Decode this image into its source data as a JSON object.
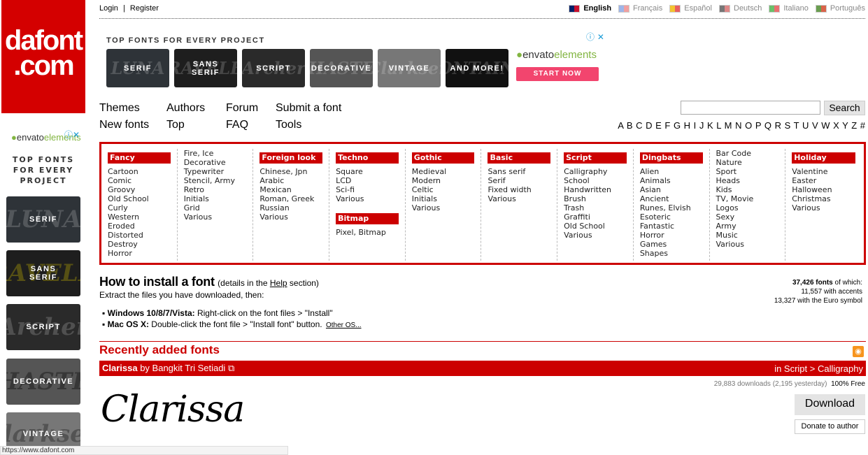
{
  "logo": {
    "line1": "dafont",
    ".com": ".com",
    "line2": ".com"
  },
  "top": {
    "login": "Login",
    "sep": "|",
    "register": "Register"
  },
  "languages": [
    {
      "label": "English",
      "active": true,
      "colors": [
        "#012169",
        "#c8102e"
      ]
    },
    {
      "label": "Français",
      "active": false,
      "colors": [
        "#9db5e8",
        "#f0a0a0"
      ]
    },
    {
      "label": "Español",
      "active": false,
      "colors": [
        "#f4c430",
        "#e86060"
      ]
    },
    {
      "label": "Deutsch",
      "active": false,
      "colors": [
        "#777",
        "#d88"
      ]
    },
    {
      "label": "Italiano",
      "active": false,
      "colors": [
        "#6bbf6b",
        "#e87070"
      ]
    },
    {
      "label": "Português",
      "active": false,
      "colors": [
        "#6a9e50",
        "#d9634a"
      ]
    }
  ],
  "ad": {
    "title": "TOP FONTS FOR EVERY PROJECT",
    "brand1": "envato",
    "brand2": "elements",
    "cta": "START NOW",
    "tiles": [
      {
        "label": "SERIF",
        "bg": "LUNA"
      },
      {
        "label": "SANS SERIF",
        "bg": "TRAVELER"
      },
      {
        "label": "SCRIPT",
        "bg": "Archer"
      },
      {
        "label": "DECORATIVE",
        "bg": "HASTE"
      },
      {
        "label": "VINTAGE",
        "bg": "Clarksen"
      },
      {
        "label": "AND MORE!",
        "bg": "FONTAINE"
      }
    ]
  },
  "side_ad": {
    "title_lines": [
      "TOP FONTS",
      "FOR EVERY",
      "PROJECT"
    ]
  },
  "nav": {
    "themes": "Themes",
    "new_fonts": "New fonts",
    "authors": "Authors",
    "top": "Top",
    "forum": "Forum",
    "faq": "FAQ",
    "submit": "Submit a font",
    "tools": "Tools"
  },
  "search": {
    "value": "",
    "button": "Search"
  },
  "alphabet": "A B C D E F G H I J K L M N O P Q R S T U V W X Y Z #",
  "categories": [
    {
      "header": "Fancy",
      "items": [
        "Cartoon",
        "Comic",
        "Groovy",
        "Old School",
        "Curly",
        "Western",
        "Eroded",
        "Distorted",
        "Destroy",
        "Horror"
      ]
    },
    {
      "header": "",
      "items": [
        "Fire, Ice",
        "Decorative",
        "Typewriter",
        "Stencil, Army",
        "Retro",
        "Initials",
        "Grid",
        "Various"
      ]
    },
    {
      "header": "Foreign look",
      "items": [
        "Chinese, Jpn",
        "Arabic",
        "Mexican",
        "Roman, Greek",
        "Russian",
        "Various"
      ]
    },
    {
      "header": "Techno",
      "items": [
        "Square",
        "LCD",
        "Sci-fi",
        "Various"
      ],
      "header2": "Bitmap",
      "items2": [
        "Pixel, Bitmap"
      ]
    },
    {
      "header": "Gothic",
      "items": [
        "Medieval",
        "Modern",
        "Celtic",
        "Initials",
        "Various"
      ]
    },
    {
      "header": "Basic",
      "items": [
        "Sans serif",
        "Serif",
        "Fixed width",
        "Various"
      ]
    },
    {
      "header": "Script",
      "items": [
        "Calligraphy",
        "School",
        "Handwritten",
        "Brush",
        "Trash",
        "Graffiti",
        "Old School",
        "Various"
      ]
    },
    {
      "header": "Dingbats",
      "items": [
        "Alien",
        "Animals",
        "Asian",
        "Ancient",
        "Runes, Elvish",
        "Esoteric",
        "Fantastic",
        "Horror",
        "Games",
        "Shapes"
      ]
    },
    {
      "header": "",
      "items": [
        "Bar Code",
        "Nature",
        "Sport",
        "Heads",
        "Kids",
        "TV, Movie",
        "Logos",
        "Sexy",
        "Army",
        "Music",
        "Various"
      ]
    },
    {
      "header": "Holiday",
      "items": [
        "Valentine",
        "Easter",
        "Halloween",
        "Christmas",
        "Various"
      ]
    }
  ],
  "install": {
    "title": "How to install a font",
    "details_pre": "(details in the ",
    "help": "Help",
    "details_post": " section)",
    "extract": "Extract the files you have downloaded, then:",
    "win_label": "Windows 10/8/7/Vista:",
    "win_text": " Right-click on the font files > \"Install\"",
    "mac_label": "Mac OS X:",
    "mac_text": " Double-click the font file > \"Install font\" button.",
    "other": "Other OS..."
  },
  "stats": {
    "total": "37,426 fonts",
    "of_which": " of which:",
    "accents": "11,557 with accents",
    "euro": "13,327 with the Euro symbol"
  },
  "recent": {
    "title": "Recently added fonts",
    "font_name": "Clarissa",
    "by": " by Bangkit Tri Setiadi",
    "category": "in Script > Calligraphy",
    "downloads": "29,883 downloads (2,195 yesterday)",
    "license": "100% Free",
    "download": "Download",
    "donate": "Donate to author",
    "preview": "Clarissa"
  },
  "status_bar": "https://www.dafont.com",
  "colors": {
    "brand_red": "#cc0000",
    "envato_green": "#82b541",
    "cta_pink": "#f2456e"
  }
}
